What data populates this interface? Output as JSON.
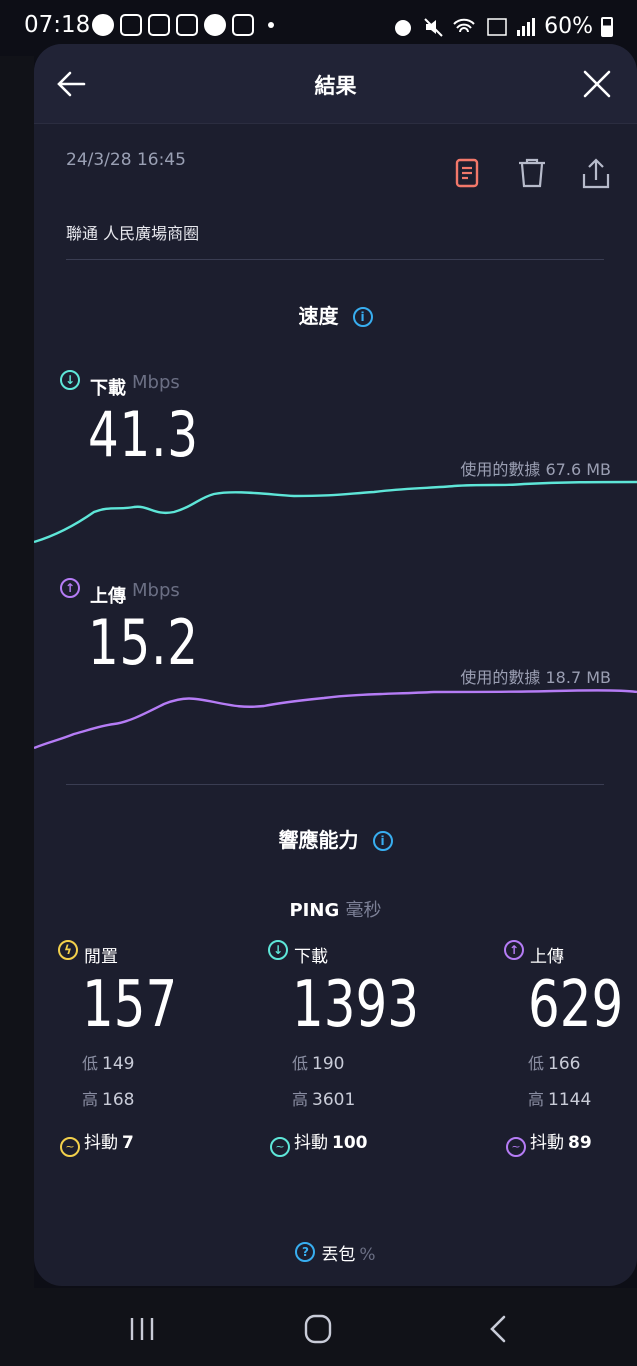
{
  "status_bar": {
    "time": "07:18",
    "battery": "60%",
    "icons_left": [
      "dnd-icon",
      "mrt-icon",
      "home-icon",
      "calendar-icon",
      "line-icon",
      "instagram-icon",
      "dot-icon"
    ],
    "icons_right": [
      "alarm-icon",
      "mute-icon",
      "wifi-icon",
      "volte-icon",
      "signal-icon",
      "battery-icon"
    ]
  },
  "header": {
    "title": "結果"
  },
  "result": {
    "datetime": "24/3/28 16:45",
    "provider": "聯通 人民廣場商圈",
    "actions": [
      "report-icon",
      "trash-icon",
      "share-icon"
    ]
  },
  "speed": {
    "title": "速度",
    "download": {
      "label": "下載",
      "unit": "Mbps",
      "value": "41.3",
      "data_used": "使用的數據 67.6 MB",
      "color": "#5ee6d8"
    },
    "upload": {
      "label": "上傳",
      "unit": "Mbps",
      "value": "15.2",
      "data_used": "使用的數據 18.7 MB",
      "color": "#b57cf5"
    }
  },
  "responsiveness": {
    "title": "響應能力",
    "ping_label": "PING",
    "ping_unit": "毫秒",
    "low_label": "低",
    "high_label": "高",
    "jitter_label": "抖動",
    "columns": [
      {
        "label": "閒置",
        "value": "157",
        "low": "149",
        "high": "168",
        "jitter": "7",
        "color": "#f2d04b"
      },
      {
        "label": "下載",
        "value": "1393",
        "low": "190",
        "high": "3601",
        "jitter": "100",
        "color": "#5ee6d8"
      },
      {
        "label": "上傳",
        "value": "629",
        "low": "166",
        "high": "1144",
        "jitter": "89",
        "color": "#b57cf5"
      }
    ]
  },
  "packet_loss": {
    "label": "丟包",
    "unit": "%"
  },
  "colors": {
    "accent_info": "#38aef0",
    "report_icon": "#f2786a",
    "sheet_bg": "#1c1e2e"
  }
}
